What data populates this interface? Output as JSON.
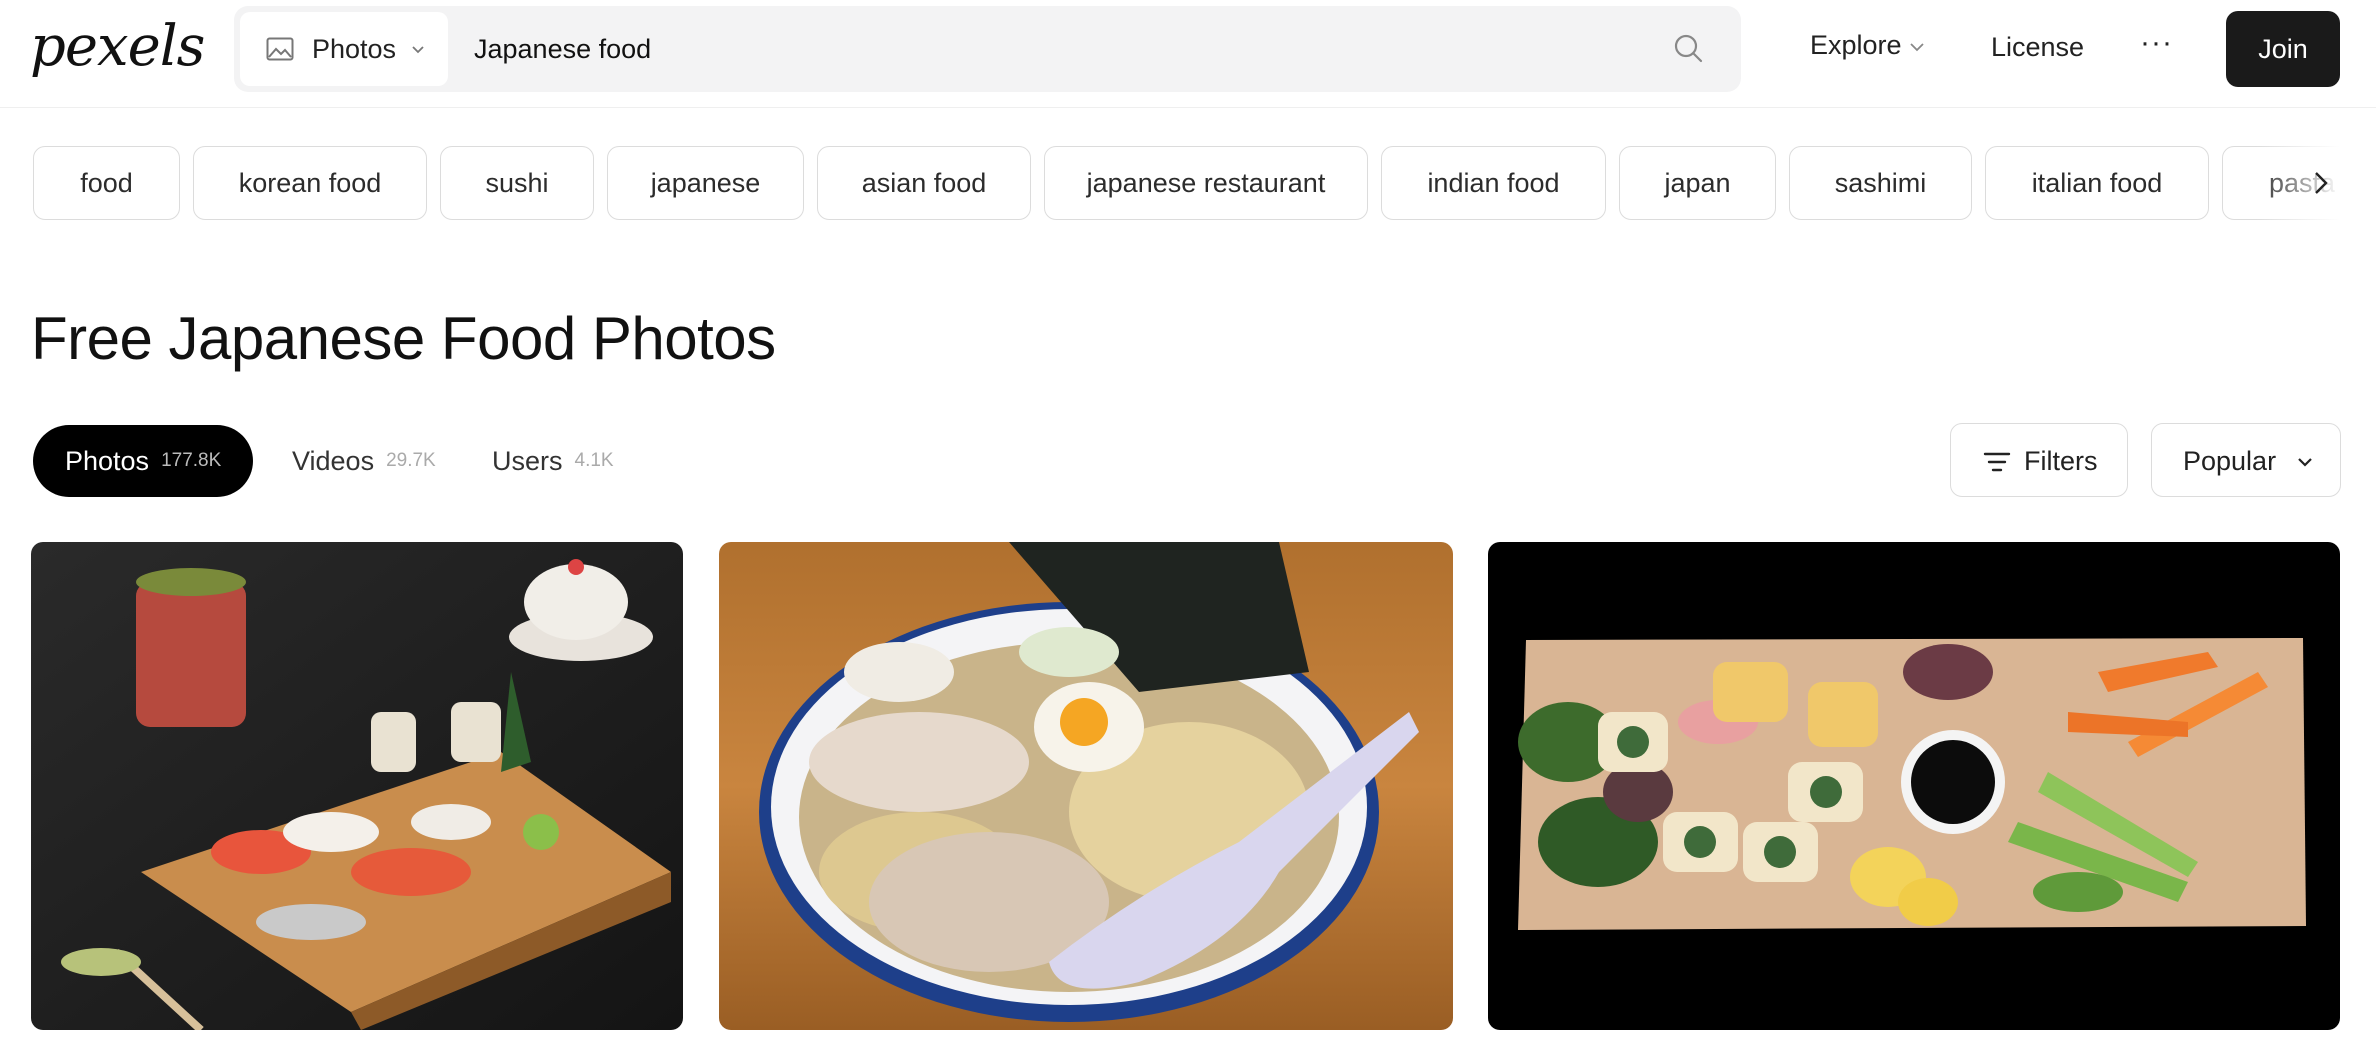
{
  "header": {
    "logo": "pexels",
    "search": {
      "type_label": "Photos",
      "query": "Japanese food"
    },
    "nav": {
      "explore": "Explore",
      "license": "License",
      "more": "···",
      "join": "Join"
    }
  },
  "related": {
    "chips": [
      "food",
      "korean food",
      "sushi",
      "japanese",
      "asian food",
      "japanese restaurant",
      "indian food",
      "japan",
      "sashimi",
      "italian food",
      "pasta"
    ]
  },
  "page_title": "Free Japanese Food Photos",
  "tabs": [
    {
      "label": "Photos",
      "count": "177.8K"
    },
    {
      "label": "Videos",
      "count": "29.7K"
    },
    {
      "label": "Users",
      "count": "4.1K"
    }
  ],
  "controls": {
    "filters": "Filters",
    "sort": "Popular"
  },
  "photos": [
    {
      "subject": "sushi platter on wooden geta with tea cup and teapot"
    },
    {
      "subject": "ramen bowl with egg, chashu and nori"
    },
    {
      "subject": "sushi rolls with soy sauce, lemon and vegetables on wooden board"
    }
  ],
  "colors": {
    "join_bg": "#1a1a1a",
    "tab_active_bg": "#000000",
    "search_bg": "#f3f3f4"
  }
}
